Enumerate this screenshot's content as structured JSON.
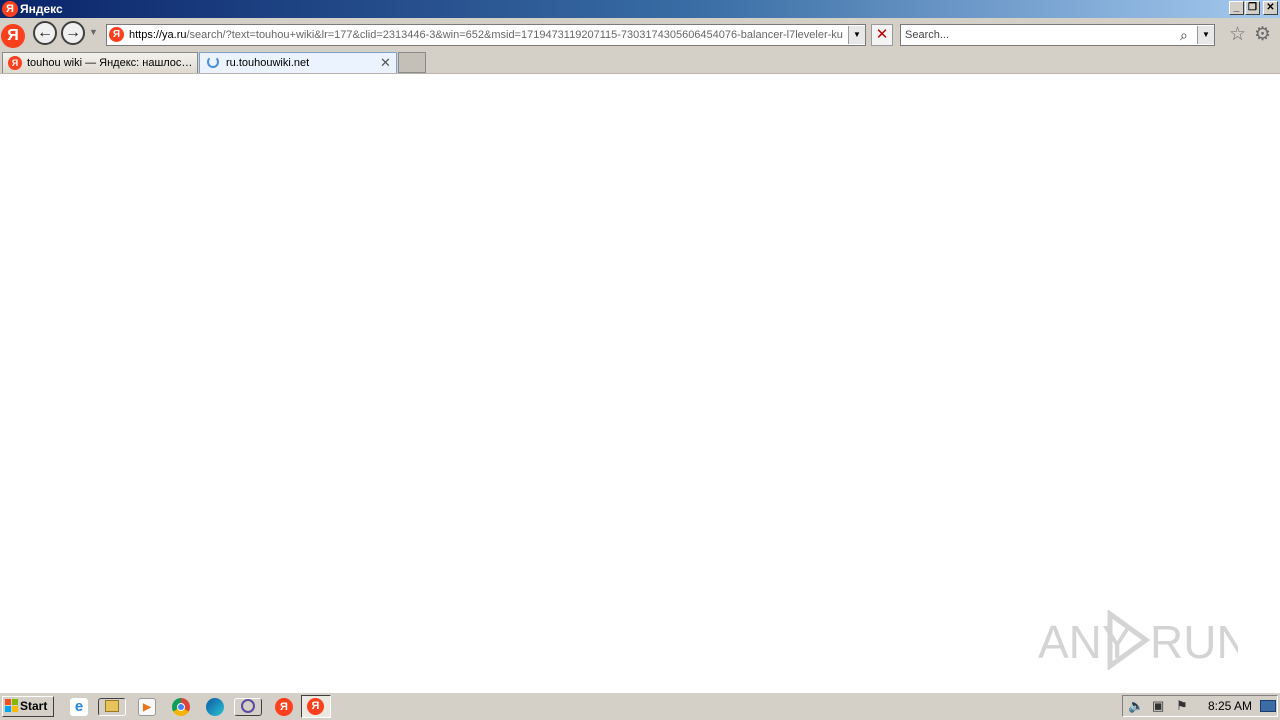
{
  "window": {
    "title": "Яндекс",
    "logo_letter": "Я",
    "controls": {
      "minimize": "_",
      "maximize": "❐",
      "close": "✕"
    }
  },
  "toolbar": {
    "brand_letter": "Я",
    "back_icon": "←",
    "forward_icon": "→",
    "history_dropdown": "▼",
    "address": {
      "url_scheme_host": "https://ya.ru",
      "url_rest": "/search/?text=touhou+wiki&lr=177&clid=2313446-3&win=652&msid=1719473119207115-7303174305606454076-balancer-l7leveler-ku",
      "dropdown_icon": "▼"
    },
    "stop_icon": "✕",
    "search": {
      "placeholder": "Search...",
      "icon": "⌕",
      "dropdown_icon": "▼"
    },
    "favorites_icon": "☆",
    "tools_icon": "⚙"
  },
  "tabs": [
    {
      "label": "touhou wiki — Яндекс: нашлос…",
      "favicon": "Я",
      "active": false
    },
    {
      "label": "ru.touhouwiki.net",
      "loading": true,
      "active": true,
      "close": "✕"
    }
  ],
  "watermark": {
    "text": "ANY RUN"
  },
  "taskbar": {
    "start_label": "Start",
    "ie_glyph": "e",
    "media_glyph": "▶",
    "yandex_glyph": "Я",
    "clock": "8:25 AM",
    "tray": {
      "sound_icon": "🔈",
      "network_icon": "▣",
      "flag_icon": "⚑"
    }
  },
  "colors": {
    "titlebar_start": "#0a246a",
    "yandex_red": "#fc3f1d",
    "chrome_face": "#d4d0c8"
  }
}
